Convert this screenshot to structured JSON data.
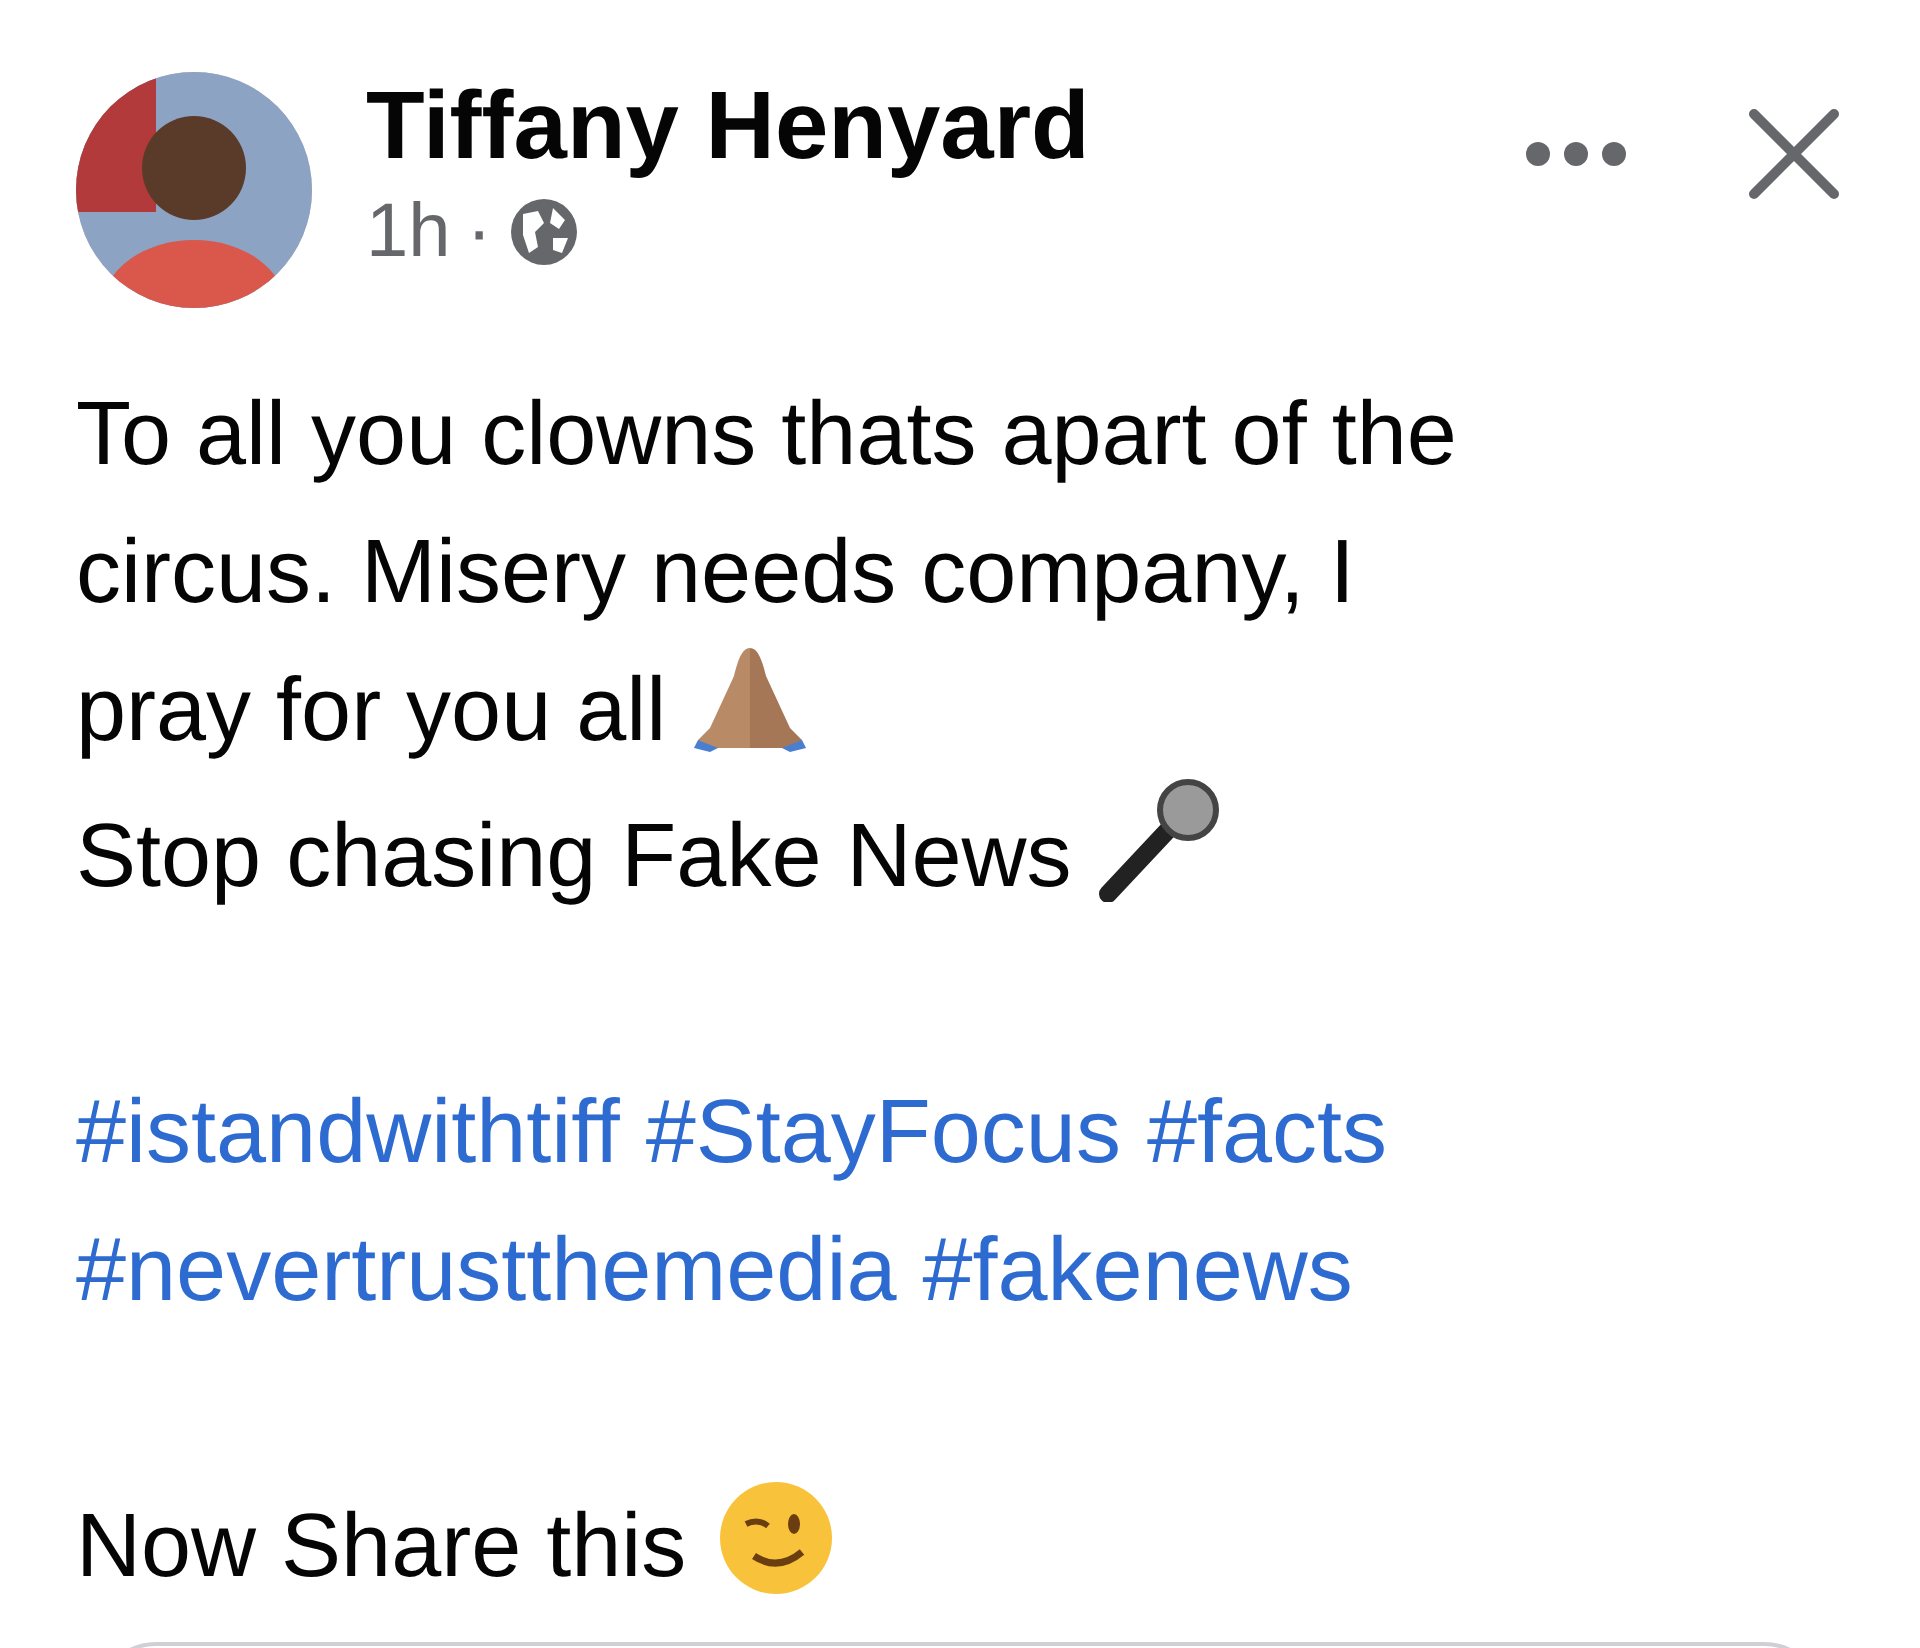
{
  "post": {
    "author": "Tiffany Henyard",
    "time": "1h",
    "separator": "·",
    "body_lines": [
      "To all you clowns thats apart of the",
      "circus. Misery needs company, I",
      "pray for you all"
    ],
    "second_line": "Stop chasing Fake News",
    "hashtag_lines": [
      [
        "#istandwithtiff",
        "#StayFocus",
        "#facts"
      ],
      [
        "#nevertrustthemedia",
        "#fakenews"
      ]
    ],
    "closing": "Now Share this"
  }
}
